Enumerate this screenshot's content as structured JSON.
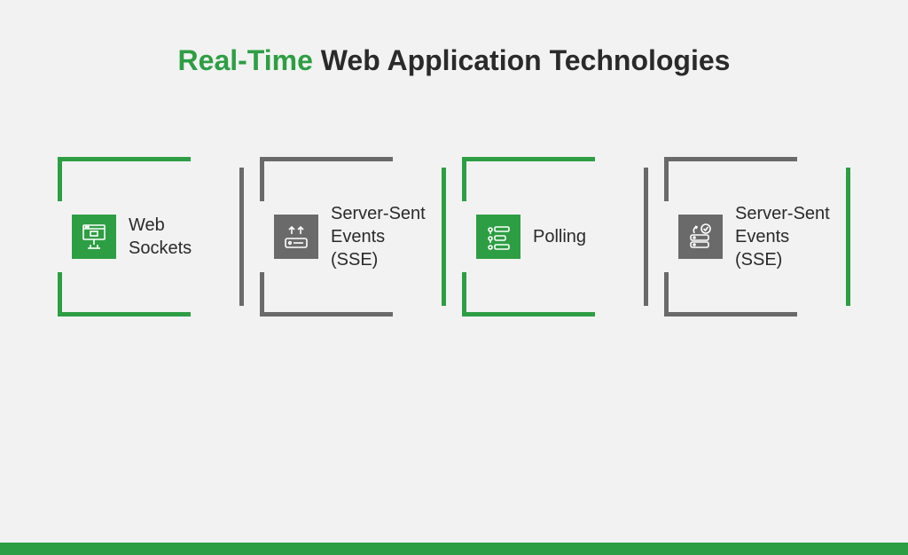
{
  "title": {
    "accent": "Real-Time",
    "rest": " Web Application Technologies"
  },
  "cards": [
    {
      "label": "Web Sockets",
      "style": "a",
      "icon": "websocket"
    },
    {
      "label": "Server-Sent Events (SSE)",
      "style": "b",
      "icon": "sse"
    },
    {
      "label": "Polling",
      "style": "a",
      "icon": "polling"
    },
    {
      "label": "Server-Sent Events (SSE)",
      "style": "b",
      "icon": "server-check"
    }
  ],
  "colors": {
    "accent": "#2e9e44",
    "gray": "#6a6a6a",
    "text": "#2a2a2a",
    "bg": "#f2f2f2"
  }
}
